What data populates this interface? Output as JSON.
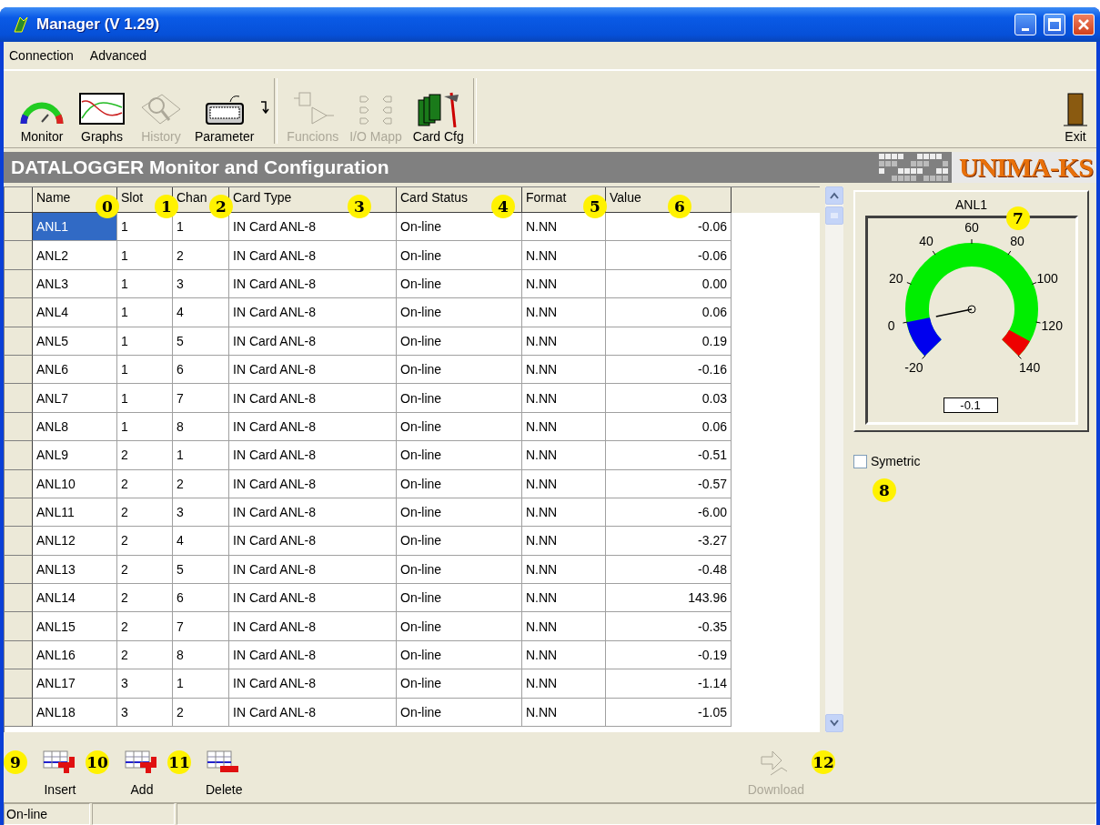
{
  "window": {
    "title": "Manager (V 1.29)"
  },
  "menu": [
    "Connection",
    "Advanced"
  ],
  "toolbar": [
    {
      "label": "Monitor",
      "kind": "gauge",
      "disabled": false
    },
    {
      "label": "Graphs",
      "kind": "chart",
      "disabled": false
    },
    {
      "label": "History",
      "kind": "magnifier",
      "disabled": true
    },
    {
      "label": "Parameter",
      "kind": "keyboard",
      "disabled": false
    },
    {
      "label": "Funcions",
      "kind": "logic",
      "disabled": true
    },
    {
      "label": "I/O Mapp",
      "kind": "io",
      "disabled": true
    },
    {
      "label": "Card Cfg",
      "kind": "cards",
      "disabled": false
    }
  ],
  "exit": {
    "label": "Exit"
  },
  "banner": {
    "title": "DATALOGGER Monitor and Configuration",
    "logo": "UNIMA-KS"
  },
  "table": {
    "columns": [
      "Name",
      "Slot",
      "Chan",
      "Card Type",
      "Card Status",
      "Format",
      "Value"
    ],
    "rows": [
      {
        "selected": true,
        "cells": [
          "ANL1",
          "1",
          "1",
          "IN Card ANL-8",
          "On-line",
          "N.NN",
          "-0.06"
        ]
      },
      {
        "selected": false,
        "cells": [
          "ANL2",
          "1",
          "2",
          "IN Card ANL-8",
          "On-line",
          "N.NN",
          "-0.06"
        ]
      },
      {
        "selected": false,
        "cells": [
          "ANL3",
          "1",
          "3",
          "IN Card ANL-8",
          "On-line",
          "N.NN",
          "0.00"
        ]
      },
      {
        "selected": false,
        "cells": [
          "ANL4",
          "1",
          "4",
          "IN Card ANL-8",
          "On-line",
          "N.NN",
          "0.06"
        ]
      },
      {
        "selected": false,
        "cells": [
          "ANL5",
          "1",
          "5",
          "IN Card ANL-8",
          "On-line",
          "N.NN",
          "0.19"
        ]
      },
      {
        "selected": false,
        "cells": [
          "ANL6",
          "1",
          "6",
          "IN Card ANL-8",
          "On-line",
          "N.NN",
          "-0.16"
        ]
      },
      {
        "selected": false,
        "cells": [
          "ANL7",
          "1",
          "7",
          "IN Card ANL-8",
          "On-line",
          "N.NN",
          "0.03"
        ]
      },
      {
        "selected": false,
        "cells": [
          "ANL8",
          "1",
          "8",
          "IN Card ANL-8",
          "On-line",
          "N.NN",
          "0.06"
        ]
      },
      {
        "selected": false,
        "cells": [
          "ANL9",
          "2",
          "1",
          "IN Card ANL-8",
          "On-line",
          "N.NN",
          "-0.51"
        ]
      },
      {
        "selected": false,
        "cells": [
          "ANL10",
          "2",
          "2",
          "IN Card ANL-8",
          "On-line",
          "N.NN",
          "-0.57"
        ]
      },
      {
        "selected": false,
        "cells": [
          "ANL11",
          "2",
          "3",
          "IN Card ANL-8",
          "On-line",
          "N.NN",
          "-6.00"
        ]
      },
      {
        "selected": false,
        "cells": [
          "ANL12",
          "2",
          "4",
          "IN Card ANL-8",
          "On-line",
          "N.NN",
          "-3.27"
        ]
      },
      {
        "selected": false,
        "cells": [
          "ANL13",
          "2",
          "5",
          "IN Card ANL-8",
          "On-line",
          "N.NN",
          "-0.48"
        ]
      },
      {
        "selected": false,
        "cells": [
          "ANL14",
          "2",
          "6",
          "IN Card ANL-8",
          "On-line",
          "N.NN",
          "143.96"
        ]
      },
      {
        "selected": false,
        "cells": [
          "ANL15",
          "2",
          "7",
          "IN Card ANL-8",
          "On-line",
          "N.NN",
          "-0.35"
        ]
      },
      {
        "selected": false,
        "cells": [
          "ANL16",
          "2",
          "8",
          "IN Card ANL-8",
          "On-line",
          "N.NN",
          "-0.19"
        ]
      },
      {
        "selected": false,
        "cells": [
          "ANL17",
          "3",
          "1",
          "IN Card ANL-8",
          "On-line",
          "N.NN",
          "-1.14"
        ]
      },
      {
        "selected": false,
        "cells": [
          "ANL18",
          "3",
          "2",
          "IN Card ANL-8",
          "On-line",
          "N.NN",
          "-1.05"
        ]
      }
    ]
  },
  "gauge": {
    "title": "ANL1",
    "ticks": [
      "-20",
      "0",
      "20",
      "40",
      "60",
      "80",
      "100",
      "120",
      "140"
    ],
    "reading": "-0.1"
  },
  "symetric": {
    "label": "Symetric",
    "checked": false
  },
  "actions": [
    {
      "label": "Insert",
      "kind": "insert",
      "disabled": false
    },
    {
      "label": "Add",
      "kind": "add",
      "disabled": false
    },
    {
      "label": "Delete",
      "kind": "delete",
      "disabled": false
    }
  ],
  "download": {
    "label": "Download",
    "disabled": true
  },
  "status_bar": [
    "On-line"
  ],
  "callouts": [
    "0",
    "1",
    "2",
    "3",
    "4",
    "5",
    "6",
    "7",
    "8",
    "9",
    "10",
    "11",
    "12"
  ]
}
